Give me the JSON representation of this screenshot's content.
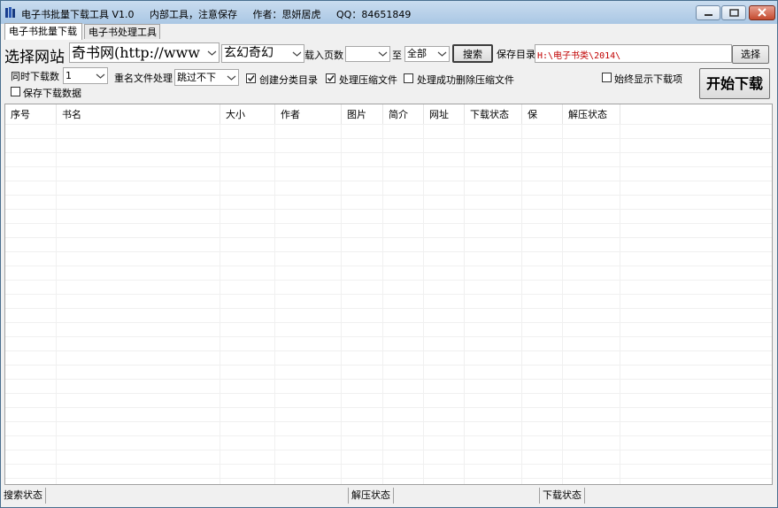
{
  "window": {
    "title_app": "电子书批量下载工具 V1.0",
    "title_note": "内部工具，注意保存",
    "title_author": "作者：思妍居虎",
    "title_qq": "QQ：84651849"
  },
  "tabs": [
    {
      "label": "电子书批量下载"
    },
    {
      "label": "电子书处理工具"
    }
  ],
  "toolbar": {
    "site_label": "选择网站",
    "site_value": "奇书网(http://www",
    "category_value": "玄幻奇幻",
    "pages_label": "载入页数",
    "pages_value": "",
    "to_label": "至",
    "to_value": "全部",
    "search_button": "搜索",
    "save_dir_label": "保存目录",
    "save_dir_value": "H:\\电子书类\\2014\\",
    "choose_button": "选择",
    "concurrent_label": "同时下载数",
    "concurrent_value": "1",
    "rename_label": "重名文件处理",
    "rename_value": "跳过不下",
    "create_category_label": "创建分类目录",
    "create_category_checked": true,
    "process_zip_label": "处理压缩文件",
    "process_zip_checked": true,
    "delete_zip_label": "处理成功删除压缩文件",
    "delete_zip_checked": false,
    "always_show_label": "始终显示下载项",
    "always_show_checked": false,
    "save_data_label": "保存下载数据",
    "save_data_checked": false,
    "start_button": "开始下载"
  },
  "table": {
    "columns": [
      "序号",
      "书名",
      "大小",
      "作者",
      "图片",
      "简介",
      "网址",
      "下载状态",
      "保",
      "解压状态"
    ],
    "rows": []
  },
  "statusbar": {
    "search_status": "搜索状态",
    "unzip_status": "解压状态",
    "download_status": "下载状态"
  }
}
